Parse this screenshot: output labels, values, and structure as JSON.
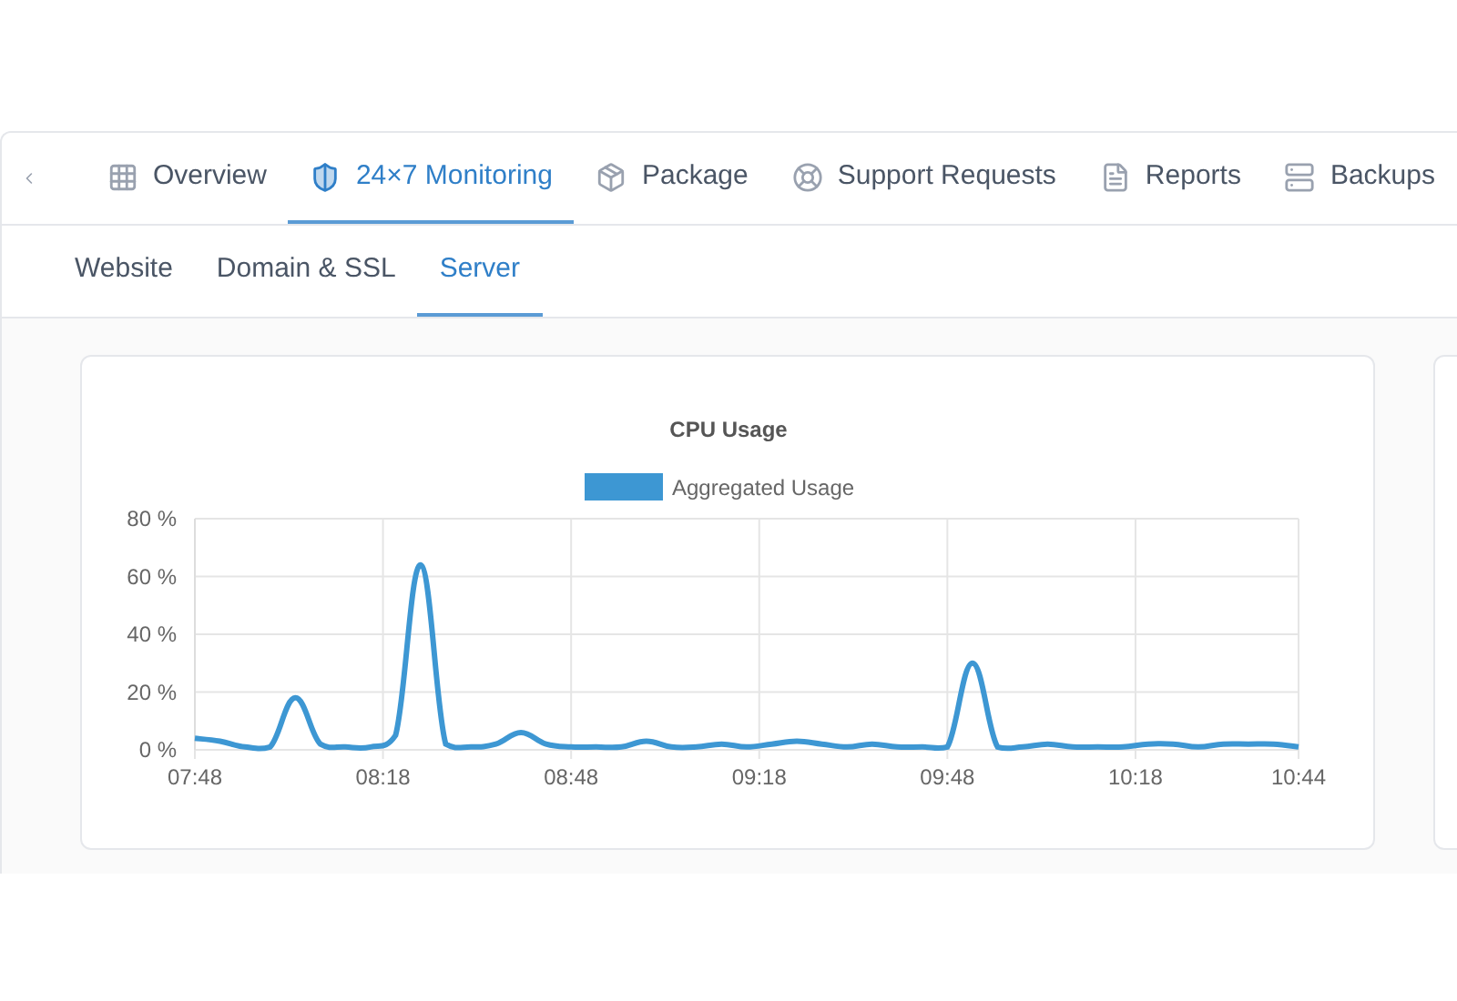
{
  "tabs": [
    {
      "label": "Overview",
      "selected": false
    },
    {
      "label": "24×7 Monitoring",
      "selected": true
    },
    {
      "label": "Package",
      "selected": false
    },
    {
      "label": "Support Requests",
      "selected": false
    },
    {
      "label": "Reports",
      "selected": false
    },
    {
      "label": "Backups",
      "selected": false
    }
  ],
  "subtabs": [
    {
      "label": "Website",
      "selected": false
    },
    {
      "label": "Domain & SSL",
      "selected": false
    },
    {
      "label": "Server",
      "selected": true
    }
  ],
  "chart": {
    "chart_data": {
      "type": "line",
      "grid": true,
      "title": "CPU Usage",
      "xlim": [
        468,
        644
      ],
      "ylim": [
        0,
        80
      ],
      "x": [
        468,
        472,
        476,
        480,
        484,
        488,
        492,
        496,
        500,
        504,
        508,
        512,
        516,
        520,
        524,
        528,
        532,
        536,
        540,
        544,
        548,
        552,
        556,
        560,
        564,
        568,
        572,
        576,
        580,
        584,
        588,
        592,
        596,
        600,
        604,
        608,
        612,
        616,
        620,
        624,
        628,
        632,
        636,
        640,
        644
      ],
      "series": [
        {
          "name": "Aggregated Usage",
          "color": "#3d97d3",
          "values": [
            4,
            3,
            1,
            1,
            18,
            2,
            1,
            1,
            5,
            64,
            2,
            1,
            2,
            6,
            2,
            1,
            1,
            1,
            3,
            1,
            1,
            2,
            1,
            2,
            3,
            2,
            1,
            2,
            1,
            1,
            1,
            30,
            1,
            1,
            2,
            1,
            1,
            1,
            2,
            2,
            1,
            2,
            2,
            2,
            1
          ]
        }
      ],
      "xticks": [
        {
          "value": 468,
          "label": "07:48"
        },
        {
          "value": 498,
          "label": "08:18"
        },
        {
          "value": 528,
          "label": "08:48"
        },
        {
          "value": 558,
          "label": "09:18"
        },
        {
          "value": 588,
          "label": "09:48"
        },
        {
          "value": 618,
          "label": "10:18"
        },
        {
          "value": 644,
          "label": "10:44"
        }
      ],
      "yticks": [
        {
          "value": 0,
          "label": "0 %"
        },
        {
          "value": 20,
          "label": "20 %"
        },
        {
          "value": 40,
          "label": "40 %"
        },
        {
          "value": 60,
          "label": "60 %"
        },
        {
          "value": 80,
          "label": "80 %"
        }
      ]
    }
  }
}
